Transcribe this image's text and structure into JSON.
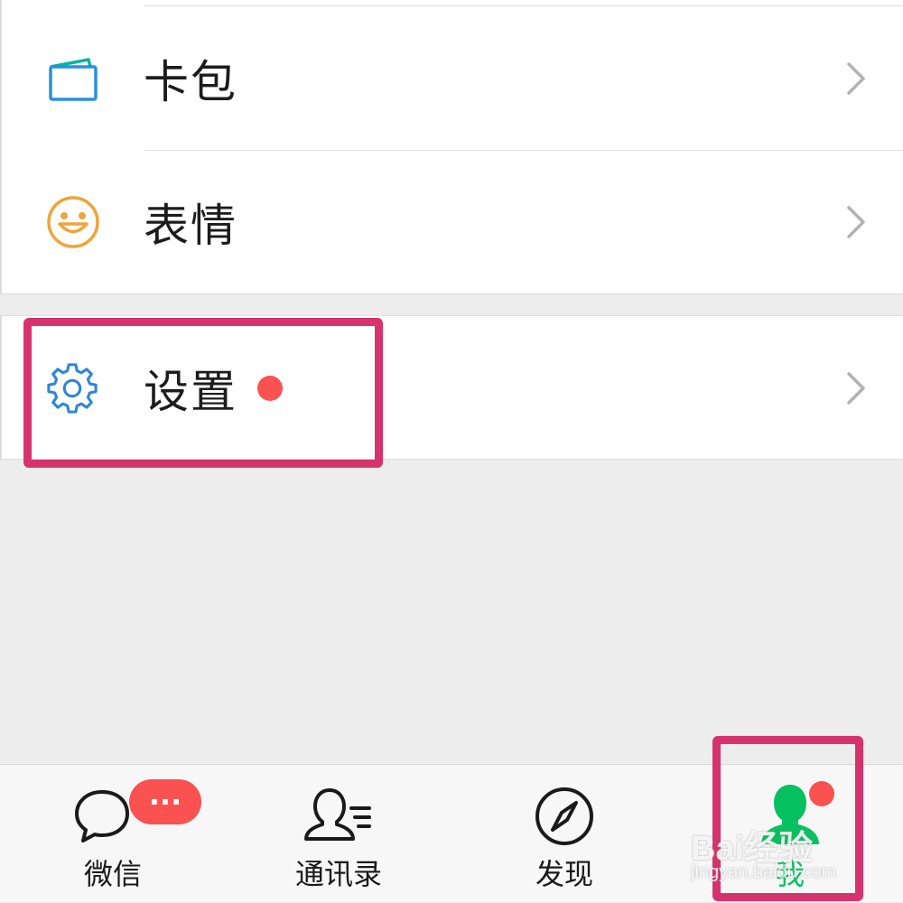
{
  "menu": {
    "items": [
      {
        "label": "卡包",
        "icon": "card-wallet-icon"
      },
      {
        "label": "表情",
        "icon": "smiley-icon"
      },
      {
        "label": "设置",
        "icon": "gear-icon",
        "has_badge": true
      }
    ]
  },
  "tabbar": {
    "tabs": [
      {
        "label": "微信",
        "icon": "chat-bubbles-icon",
        "badge": "···"
      },
      {
        "label": "通讯录",
        "icon": "contacts-icon"
      },
      {
        "label": "发现",
        "icon": "compass-icon"
      },
      {
        "label": "我",
        "icon": "person-icon",
        "active": true,
        "has_badge": true
      }
    ]
  },
  "watermark": {
    "brand": "Bai经验",
    "site": "jingyan.baidu.com"
  },
  "colors": {
    "accent_green": "#07c160",
    "badge_red": "#fa5151",
    "highlight": "#d6336c",
    "card_icon": "#2a8fe0",
    "smiley_icon": "#f0a43a",
    "gear_icon": "#2f86d6"
  }
}
